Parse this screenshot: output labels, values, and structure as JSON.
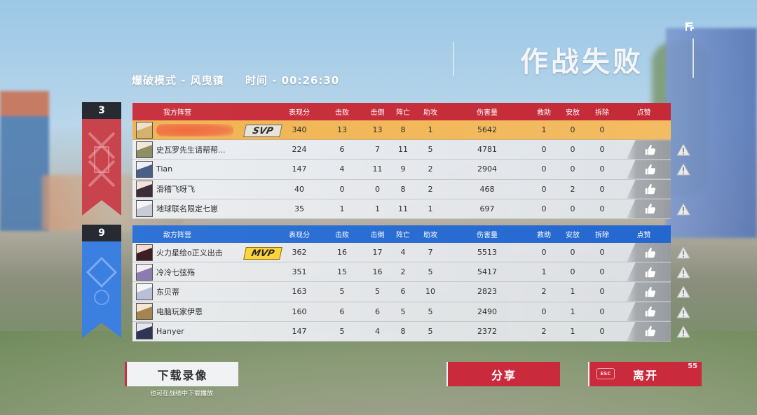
{
  "header": {
    "result": "作战失败",
    "mode": "爆破模式 - 风曳镇",
    "time": "时间 - 00:26:30",
    "corner_icon": "flag-icon"
  },
  "columns": [
    "表现分",
    "击败",
    "击倒",
    "阵亡",
    "助攻",
    "伤害量",
    "救助",
    "安放",
    "拆除",
    "点赞"
  ],
  "teams": {
    "ally": {
      "score": "3",
      "title": "我方阵营",
      "color": "#c9323f",
      "players": [
        {
          "name": "",
          "tag": "SVP",
          "score": "340",
          "kill": "13",
          "down": "13",
          "death": "8",
          "assist": "1",
          "damage": "5642",
          "rescue": "1",
          "plant": "0",
          "defuse": "0"
        },
        {
          "name": "史瓦罗先生请帮帮...",
          "tag": "",
          "score": "224",
          "kill": "6",
          "down": "7",
          "death": "11",
          "assist": "5",
          "damage": "4781",
          "rescue": "0",
          "plant": "0",
          "defuse": "0"
        },
        {
          "name": "Tian",
          "tag": "",
          "score": "147",
          "kill": "4",
          "down": "11",
          "death": "9",
          "assist": "2",
          "damage": "2904",
          "rescue": "0",
          "plant": "0",
          "defuse": "0"
        },
        {
          "name": "滑稽飞呀飞",
          "tag": "",
          "score": "40",
          "kill": "0",
          "down": "0",
          "death": "8",
          "assist": "2",
          "damage": "468",
          "rescue": "0",
          "plant": "2",
          "defuse": "0"
        },
        {
          "name": "地球联名限定七崽",
          "tag": "",
          "score": "35",
          "kill": "1",
          "down": "1",
          "death": "11",
          "assist": "1",
          "damage": "697",
          "rescue": "0",
          "plant": "0",
          "defuse": "0"
        }
      ]
    },
    "enemy": {
      "score": "9",
      "title": "敌方阵营",
      "color": "#2f73d6",
      "players": [
        {
          "name": "火力星绘o正义出击",
          "tag": "MVP",
          "score": "362",
          "kill": "16",
          "down": "17",
          "death": "4",
          "assist": "7",
          "damage": "5513",
          "rescue": "0",
          "plant": "0",
          "defuse": "0"
        },
        {
          "name": "冷冷七弦殇",
          "tag": "",
          "score": "351",
          "kill": "15",
          "down": "16",
          "death": "2",
          "assist": "5",
          "damage": "5417",
          "rescue": "1",
          "plant": "0",
          "defuse": "0"
        },
        {
          "name": "东贝蒂",
          "tag": "",
          "score": "163",
          "kill": "5",
          "down": "5",
          "death": "6",
          "assist": "10",
          "damage": "2823",
          "rescue": "2",
          "plant": "1",
          "defuse": "0"
        },
        {
          "name": "电脑玩家伊恩",
          "tag": "",
          "score": "160",
          "kill": "6",
          "down": "6",
          "death": "5",
          "assist": "5",
          "damage": "2490",
          "rescue": "0",
          "plant": "1",
          "defuse": "0"
        },
        {
          "name": "Hanyer",
          "tag": "",
          "score": "147",
          "kill": "5",
          "down": "4",
          "death": "8",
          "assist": "5",
          "damage": "2372",
          "rescue": "2",
          "plant": "1",
          "defuse": "0"
        }
      ]
    }
  },
  "buttons": {
    "download": "下载录像",
    "download_sub": "也可在战绩中下载播放",
    "share": "分享",
    "leave": "离开",
    "leave_key": "ESC",
    "leave_countdown": "55"
  }
}
